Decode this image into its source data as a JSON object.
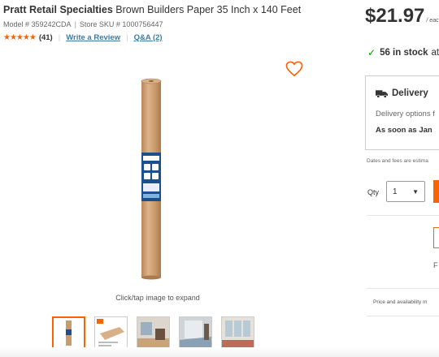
{
  "product": {
    "brand": "Pratt Retail Specialties",
    "name": "Brown Builders Paper 35 Inch x 140 Feet",
    "model_label": "Model # 359242CDA",
    "sku_label": "Store SKU # 1000756447",
    "meta_separator": "|",
    "rating_stars": "★★★★★",
    "rating_value": 4.5,
    "rating_count": "(41)",
    "write_review": "Write a Review",
    "qa_link": "Q&A (2)",
    "link_separator": "|"
  },
  "gallery": {
    "expand_hint": "Click/tap image to expand",
    "thumbnails": [
      "roll",
      "paper-sheet",
      "room-1",
      "room-2",
      "room-3"
    ],
    "selected_index": 0
  },
  "pricing": {
    "price": "$21.97",
    "unit": "/ eac"
  },
  "stock": {
    "count": "56 in stock",
    "suffix": "at"
  },
  "delivery": {
    "title": "Delivery",
    "options": "Delivery options f",
    "soon": "As soon as Jan"
  },
  "notes": {
    "fees": "Dates and fees are estima",
    "price_availability": "Price and availability m"
  },
  "quantity": {
    "label": "Qty",
    "value": "1",
    "caret": "▼"
  },
  "partial": {
    "letter": "F"
  },
  "colors": {
    "accent": "#f96302",
    "link": "#3e7ba0",
    "check": "#00a000",
    "kraft": "#c99a6a"
  },
  "icons": {
    "favorite": "heart-outline-icon",
    "delivery": "truck-icon",
    "stock": "checkmark-icon"
  }
}
